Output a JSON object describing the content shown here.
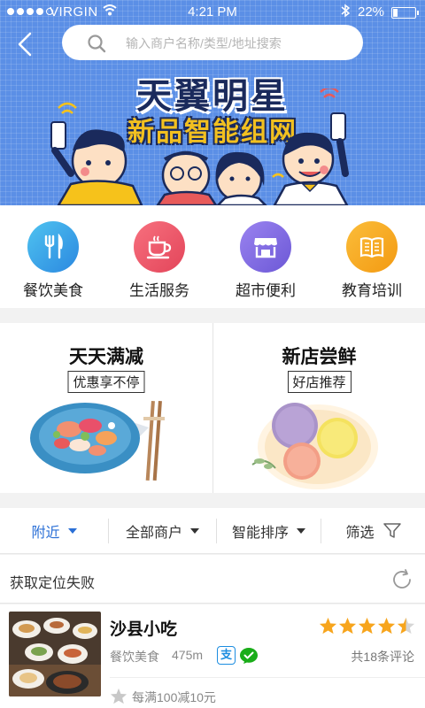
{
  "status_bar": {
    "carrier": "VIRGIN",
    "time": "4:21 PM",
    "battery": "22%",
    "battery_level": 0.22
  },
  "search": {
    "placeholder": "输入商户名称/类型/地址搜索"
  },
  "banner": {
    "headline": "天翼明星",
    "subheadline": "新品智能组网"
  },
  "categories": [
    {
      "label": "餐饮美食",
      "icon": "utensils-icon",
      "color": "#3aa3e3"
    },
    {
      "label": "生活服务",
      "icon": "coffee-cup-icon",
      "color": "#ef5a6a"
    },
    {
      "label": "超市便利",
      "icon": "storefront-icon",
      "color": "#7d6ae0"
    },
    {
      "label": "教育培训",
      "icon": "open-book-icon",
      "color": "#f7a51d"
    }
  ],
  "promos": [
    {
      "title": "天天满减",
      "tag": "优惠享不停"
    },
    {
      "title": "新店尝鲜",
      "tag": "好店推荐"
    }
  ],
  "filters": [
    {
      "label": "附近",
      "active": true
    },
    {
      "label": "全部商户",
      "active": false
    },
    {
      "label": "智能排序",
      "active": false
    },
    {
      "label": "筛选",
      "active": false
    }
  ],
  "location": {
    "text": "获取定位失败"
  },
  "shop": {
    "name": "沙县小吃",
    "category": "餐饮美食",
    "distance": "475m",
    "alipay_label": "支",
    "rating": 4.5,
    "reviews": "共18条评论",
    "deal": "每满100减10元"
  },
  "colors": {
    "accent": "#2a6fd6",
    "star": "#f7a51d",
    "banner": "#5b8fe6"
  }
}
